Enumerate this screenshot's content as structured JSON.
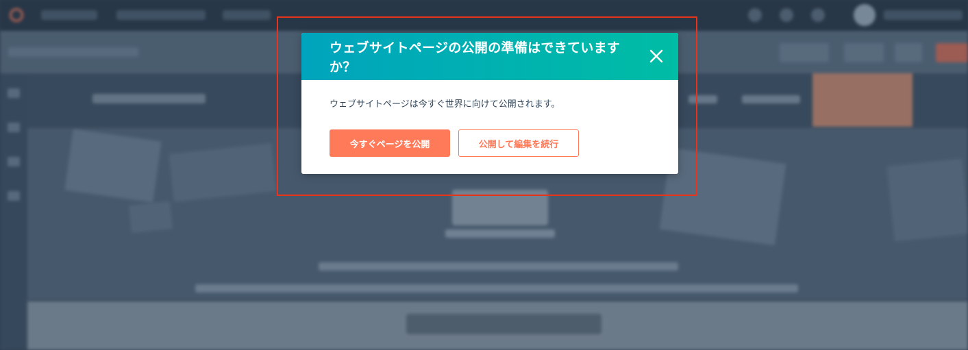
{
  "dialog": {
    "title": "ウェブサイトページの公開の準備はできていますか？",
    "message": "ウェブサイトページは今すぐ世界に向けて公開されます。",
    "primary_button": "今すぐページを公開",
    "secondary_button": "公開して編集を続行",
    "close_icon": "close-icon"
  },
  "colors": {
    "header_gradient_start": "#00a4bd",
    "header_gradient_end": "#00bda5",
    "accent": "#ff7a59",
    "text": "#33475b",
    "highlight": "#e8341c"
  }
}
